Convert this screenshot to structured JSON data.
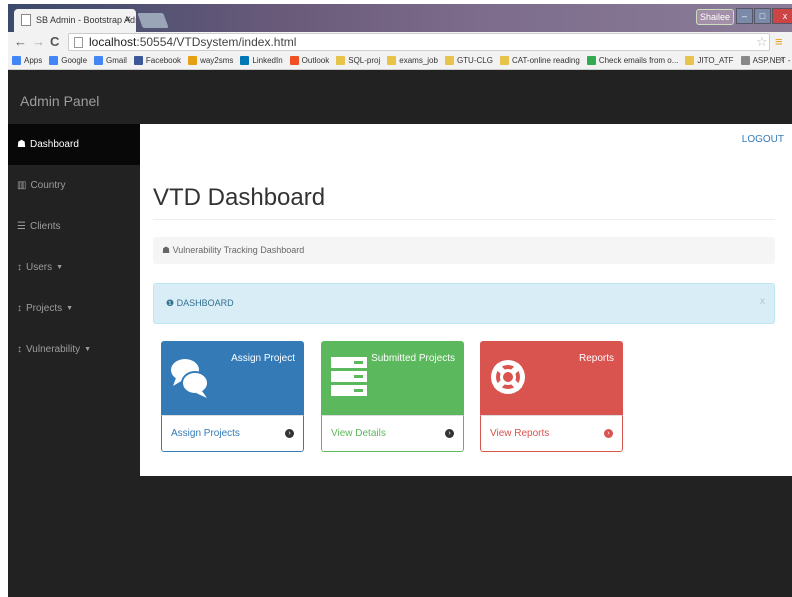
{
  "browser": {
    "tab_title": "SB Admin - Bootstrap Adı",
    "user_badge": "Shailee",
    "url_host": "localhost",
    "url_rest": ":50554/VTDsystem/index.html",
    "bookmarks": [
      {
        "label": "Apps",
        "icon": "apps-grid-icon",
        "color": "#4285f4"
      },
      {
        "label": "Google",
        "icon": "google-icon",
        "color": "#4285f4"
      },
      {
        "label": "Gmail",
        "icon": "gmail-icon",
        "color": "#4285f4"
      },
      {
        "label": "Facebook",
        "icon": "facebook-icon",
        "color": "#3b5998"
      },
      {
        "label": "way2sms",
        "icon": "way2sms-icon",
        "color": "#e8a013"
      },
      {
        "label": "LinkedIn",
        "icon": "linkedin-icon",
        "color": "#0077b5"
      },
      {
        "label": "Outlook",
        "icon": "outlook-icon",
        "color": "#f25022"
      },
      {
        "label": "SQL-proj",
        "icon": "folder-icon",
        "color": "#e8c34a"
      },
      {
        "label": "exams_job",
        "icon": "folder-icon",
        "color": "#e8c34a"
      },
      {
        "label": "GTU-CLG",
        "icon": "folder-icon",
        "color": "#e8c34a"
      },
      {
        "label": "CAT-online reading",
        "icon": "folder-icon",
        "color": "#e8c34a"
      },
      {
        "label": "Check emails from o...",
        "icon": "check-emails-icon",
        "color": "#34a853"
      },
      {
        "label": "JITO_ATF",
        "icon": "folder-icon",
        "color": "#e8c34a"
      },
      {
        "label": "ASP.NET - Validators",
        "icon": "aspnet-icon",
        "color": "#888888"
      }
    ],
    "bookmarks_more": "»"
  },
  "app": {
    "brand": "Admin Panel",
    "logout": "LOGOUT",
    "sidebar": [
      {
        "label": "Dashboard",
        "icon": "dashboard-icon",
        "glyph": "☗",
        "active": true,
        "caret": ""
      },
      {
        "label": "Country",
        "icon": "bar-chart-icon",
        "glyph": "▥",
        "active": false,
        "caret": ""
      },
      {
        "label": "Clients",
        "icon": "list-icon",
        "glyph": "☰",
        "active": false,
        "caret": ""
      },
      {
        "label": "Users",
        "icon": "sort-icon",
        "glyph": "↕",
        "active": false,
        "caret": "▼"
      },
      {
        "label": "Projects",
        "icon": "sort-icon",
        "glyph": "↕",
        "active": false,
        "caret": "▼"
      },
      {
        "label": "Vulnerability",
        "icon": "sort-icon",
        "glyph": "↕",
        "active": false,
        "caret": "▼"
      }
    ],
    "page_title": "VTD Dashboard",
    "breadcrumb": "Vulnerability Tracking Dashboard",
    "alert": "DASHBOARD",
    "alert_close": "x",
    "panels": [
      {
        "title": "Assign Project",
        "link": "Assign Projects",
        "icon": "comments-icon",
        "color": "#337ab7"
      },
      {
        "title": "Submitted Projects",
        "link": "View Details",
        "icon": "server-icon",
        "color": "#5cb85c"
      },
      {
        "title": "Reports",
        "link": "View Reports",
        "icon": "life-ring-icon",
        "color": "#d9534f"
      }
    ]
  }
}
